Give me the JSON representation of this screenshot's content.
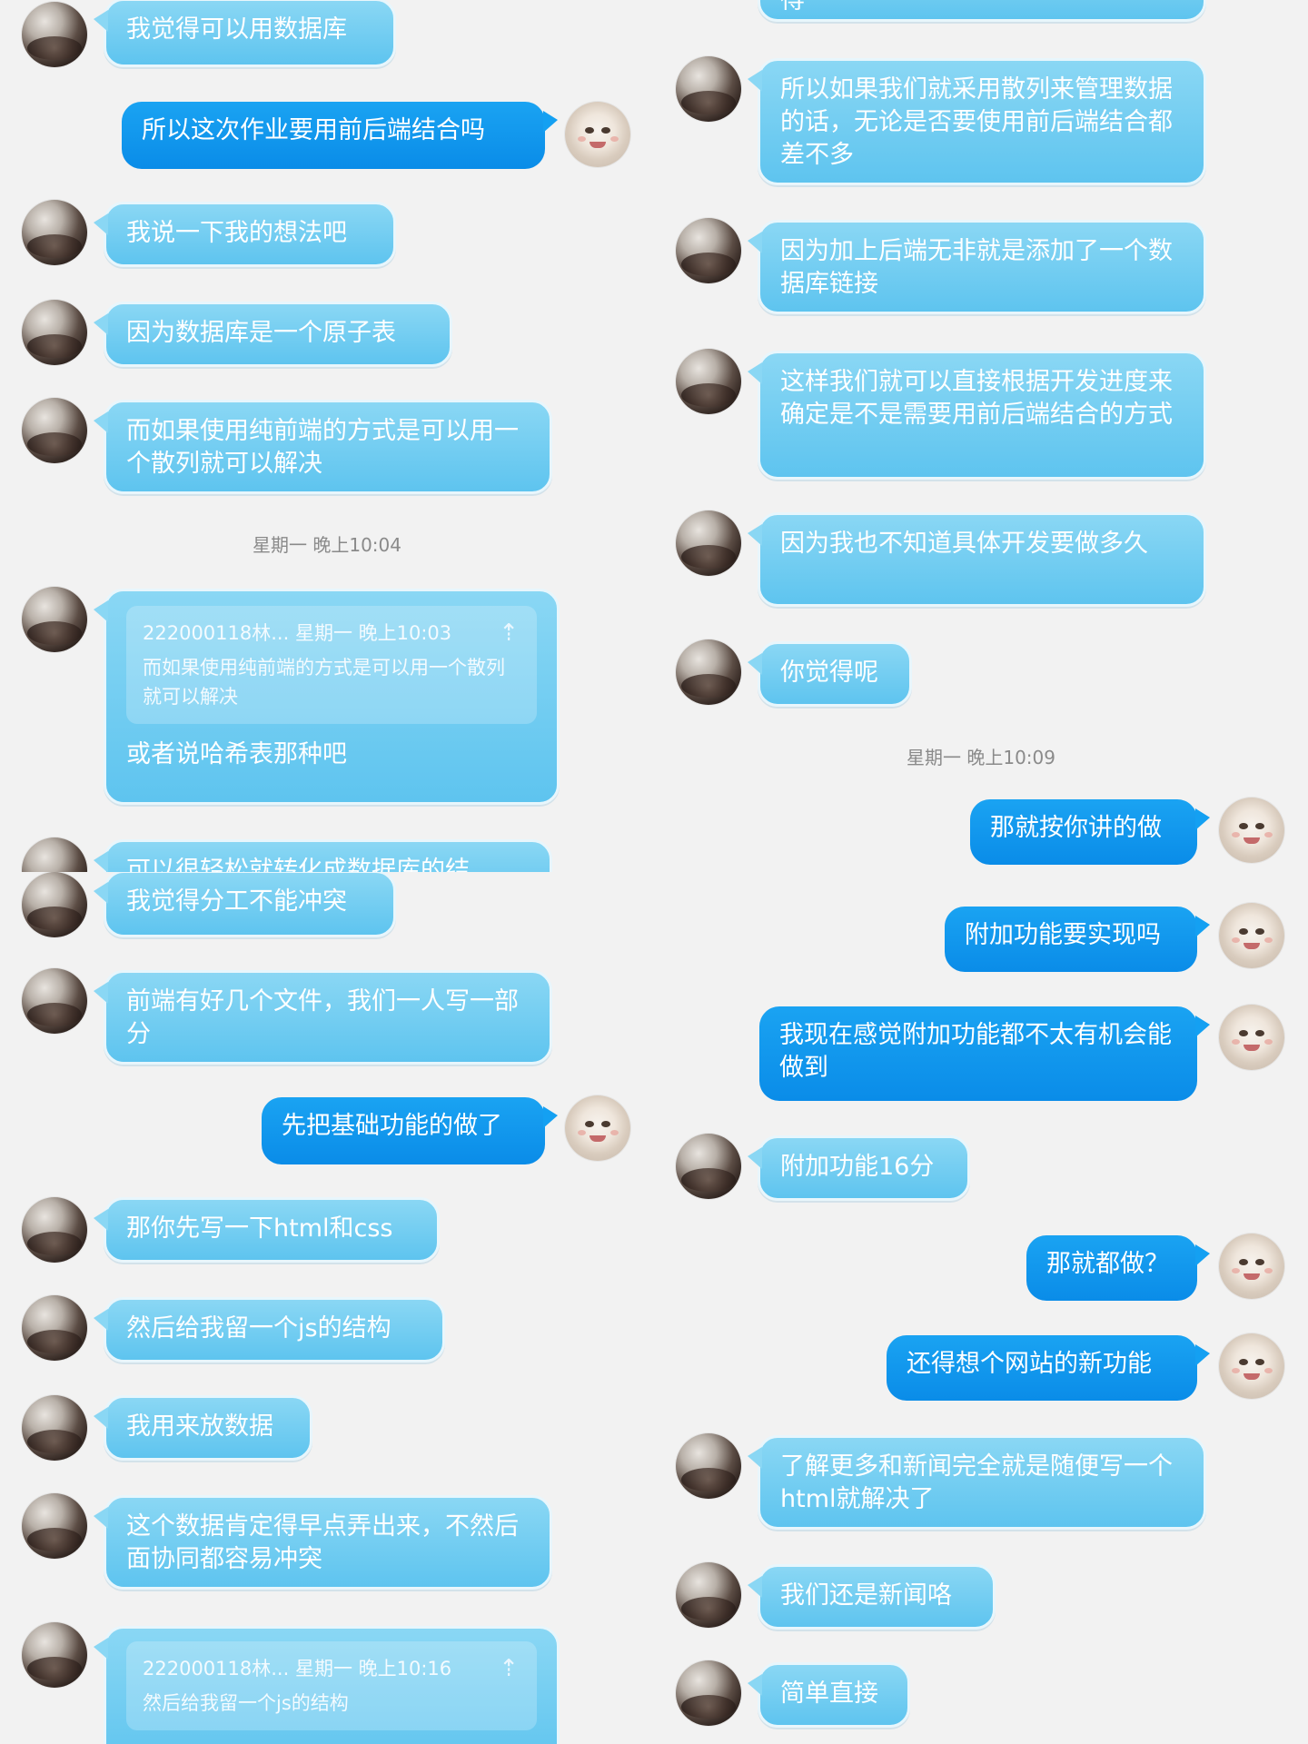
{
  "panels": [
    {
      "messages": [
        {
          "side": "in",
          "text": "我觉得可以用数据库"
        },
        {
          "side": "out",
          "text": "所以这次作业要用前后端结合吗"
        },
        {
          "side": "in",
          "text": "我说一下我的想法吧"
        },
        {
          "side": "in",
          "text": "因为数据库是一个原子表"
        },
        {
          "side": "in",
          "text": "而如果使用纯前端的方式是可以用一个散列就可以解决"
        },
        {
          "timestamp": "星期一 晚上10:04"
        },
        {
          "side": "in",
          "quote_header": "222000118林... 星期一 晚上10:03",
          "quote_text": "而如果使用纯前端的方式是可以用一个散列就可以解决",
          "text": "或者说哈希表那种吧"
        },
        {
          "side": "in",
          "text": "可以很轻松就转化成数据库的结"
        }
      ]
    },
    {
      "messages": [
        {
          "side": "in",
          "text": "得"
        },
        {
          "side": "in",
          "text": "所以如果我们就采用散列来管理数据的话，无论是否要使用前后端结合都差不多"
        },
        {
          "side": "in",
          "text": "因为加上后端无非就是添加了一个数据库链接"
        },
        {
          "side": "in",
          "text": "这样我们就可以直接根据开发进度来确定是不是需要用前后端结合的方式"
        },
        {
          "side": "in",
          "text": "因为我也不知道具体开发要做多久"
        },
        {
          "side": "in",
          "text": "你觉得呢"
        },
        {
          "timestamp": "星期一 晚上10:09"
        },
        {
          "side": "out",
          "text": "那就按你讲的做"
        }
      ]
    },
    {
      "messages": [
        {
          "side": "in",
          "text": "我觉得分工不能冲突"
        },
        {
          "side": "in",
          "text": "前端有好几个文件，我们一人写一部分"
        },
        {
          "side": "out",
          "text": "先把基础功能的做了"
        },
        {
          "side": "in",
          "text": "那你先写一下html和css"
        },
        {
          "side": "in",
          "text": "然后给我留一个js的结构"
        },
        {
          "side": "in",
          "text": "我用来放数据"
        },
        {
          "side": "in",
          "text": "这个数据肯定得早点弄出来，不然后面协同都容易冲突"
        },
        {
          "side": "in",
          "quote_header": "222000118林... 星期一 晚上10:16",
          "quote_text": "然后给我留一个js的结构",
          "text": ""
        }
      ]
    },
    {
      "messages": [
        {
          "side": "out",
          "text": "附加功能要实现吗"
        },
        {
          "side": "out",
          "text": "我现在感觉附加功能都不太有机会能做到"
        },
        {
          "side": "in",
          "text": "附加功能16分"
        },
        {
          "side": "out",
          "text": "那就都做？"
        },
        {
          "side": "out",
          "text": "还得想个网站的新功能"
        },
        {
          "side": "in",
          "text": "了解更多和新闻完全就是随便写一个html就解决了"
        },
        {
          "side": "in",
          "text": "我们还是新闻咯"
        },
        {
          "side": "in",
          "text": "简单直接"
        }
      ]
    }
  ],
  "colors": {
    "background": "#f2f2f2",
    "incoming_bubble": "#6fcbf1",
    "outgoing_bubble": "#0f96ed",
    "timestamp_text": "#8a8a8a"
  },
  "icons": {
    "quote_jump": "arrow-up-icon",
    "peer_avatar": "peer-avatar",
    "self_avatar": "self-avatar"
  }
}
